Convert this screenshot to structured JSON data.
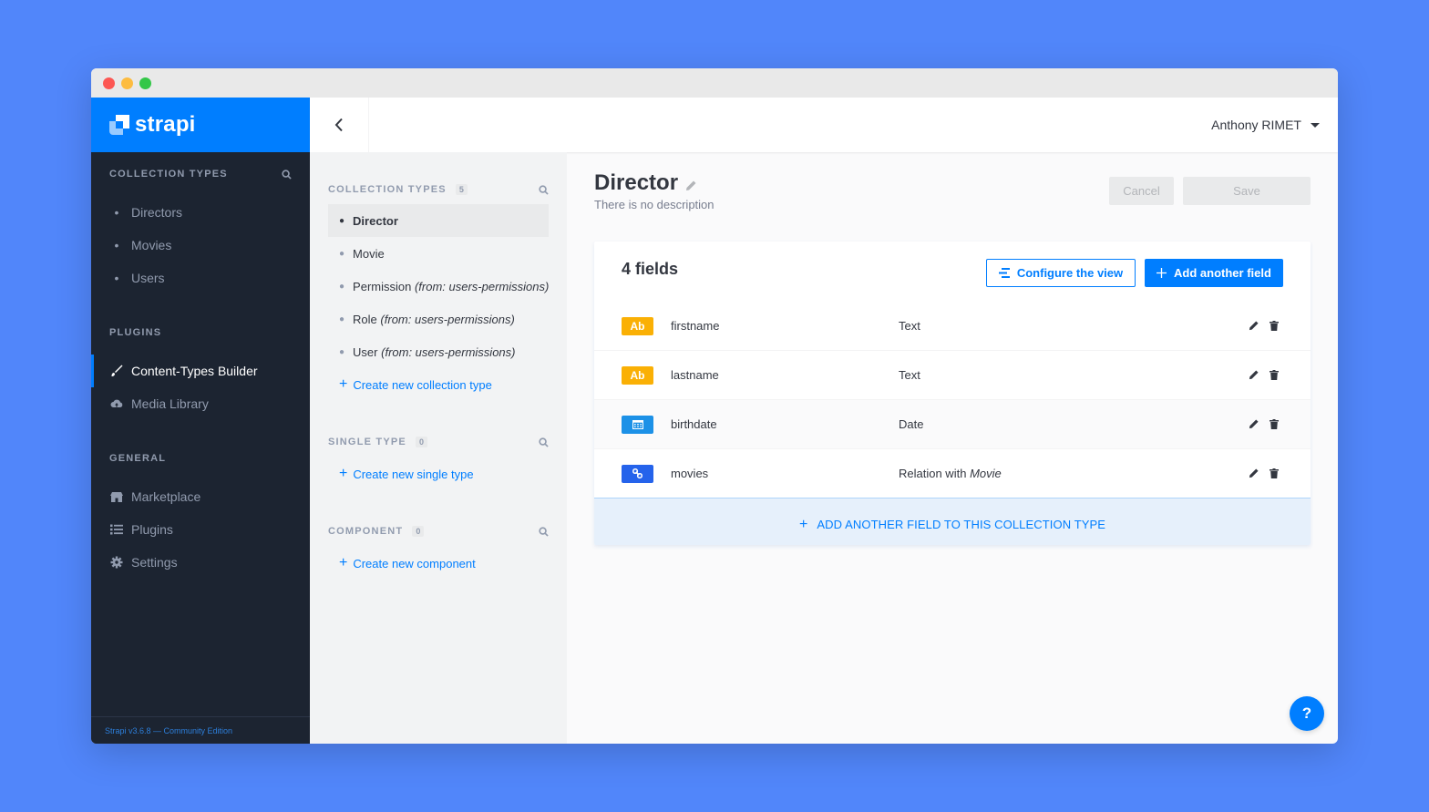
{
  "brand": {
    "name": "strapi"
  },
  "user": {
    "name": "Anthony RIMET"
  },
  "leftnav": {
    "collection_title": "COLLECTION TYPES",
    "collection_items": [
      "Directors",
      "Movies",
      "Users"
    ],
    "plugins_title": "PLUGINS",
    "plugins_items": [
      {
        "label": "Content-Types Builder",
        "icon": "paintbrush-icon",
        "active": true
      },
      {
        "label": "Media Library",
        "icon": "cloud-icon",
        "active": false
      }
    ],
    "general_title": "GENERAL",
    "general_items": [
      {
        "label": "Marketplace",
        "icon": "store-icon"
      },
      {
        "label": "Plugins",
        "icon": "list-icon"
      },
      {
        "label": "Settings",
        "icon": "gear-icon"
      }
    ],
    "footer": "Strapi v3.6.8 — Community Edition"
  },
  "subnav": {
    "collection_title": "COLLECTION TYPES",
    "collection_count": "5",
    "items": [
      {
        "label": "Director",
        "suffix": "",
        "active": true
      },
      {
        "label": "Movie",
        "suffix": "",
        "active": false
      },
      {
        "label": "Permission",
        "suffix": "(from: users-permissions)",
        "active": false
      },
      {
        "label": "Role",
        "suffix": "(from: users-permissions)",
        "active": false
      },
      {
        "label": "User",
        "suffix": "(from: users-permissions)",
        "active": false
      }
    ],
    "create_collection": "Create new collection type",
    "single_title": "SINGLE TYPE",
    "single_count": "0",
    "create_single": "Create new single type",
    "component_title": "COMPONENT",
    "component_count": "0",
    "create_component": "Create new component"
  },
  "main": {
    "title": "Director",
    "description": "There is no description",
    "cancel_label": "Cancel",
    "save_label": "Save",
    "fields_count": "4 fields",
    "configure_label": "Configure the view",
    "add_field_label": "Add another field",
    "fields": [
      {
        "badge": "Ab",
        "kind": "text",
        "name": "firstname",
        "type": "Text",
        "type_suffix": ""
      },
      {
        "badge": "Ab",
        "kind": "text",
        "name": "lastname",
        "type": "Text",
        "type_suffix": ""
      },
      {
        "badge": "",
        "kind": "date",
        "name": "birthdate",
        "type": "Date",
        "type_suffix": ""
      },
      {
        "badge": "",
        "kind": "rel",
        "name": "movies",
        "type": "Relation with",
        "type_suffix": "Movie"
      }
    ],
    "add_footer_label": "ADD ANOTHER FIELD TO THIS COLLECTION TYPE",
    "help_label": "?"
  },
  "colors": {
    "primary": "#007eff",
    "nav_bg": "#1c2431",
    "text_badge": "#fab005"
  }
}
